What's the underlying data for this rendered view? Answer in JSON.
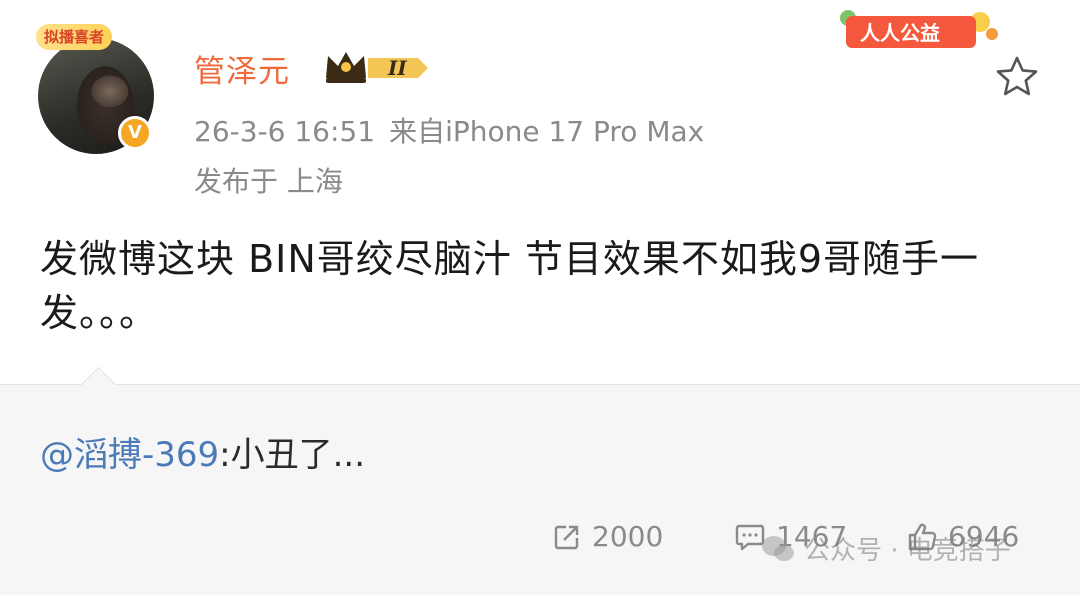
{
  "post": {
    "avatar_badge": "拟播喜者",
    "verified_mark": "V",
    "username": "管泽元",
    "vip_level": "II",
    "date_time": "26-3-6 16:51",
    "source": "来自iPhone 17 Pro Max",
    "location": "发布于 上海",
    "charity_badge": "人人公益",
    "text": "发微博这块 BIN哥绞尽脑汁 节目效果不如我9哥随手一发。。。"
  },
  "repost": {
    "mention": "@滔搏-369",
    "content": ":小丑了..."
  },
  "actions": {
    "forward_count": "2000",
    "comment_count": "1467",
    "like_count": "6946"
  },
  "watermark": {
    "text": "公众号 · 电竞搭子"
  },
  "colors": {
    "username": "#f0693b",
    "meta": "#8a8a8a",
    "mention": "#4a7ab8",
    "repost_bg": "#f6f6f6"
  },
  "icons": [
    "verified-badge-icon",
    "vip-crown-icon",
    "star-icon",
    "forward-icon",
    "comment-icon",
    "like-icon",
    "wechat-icon"
  ]
}
